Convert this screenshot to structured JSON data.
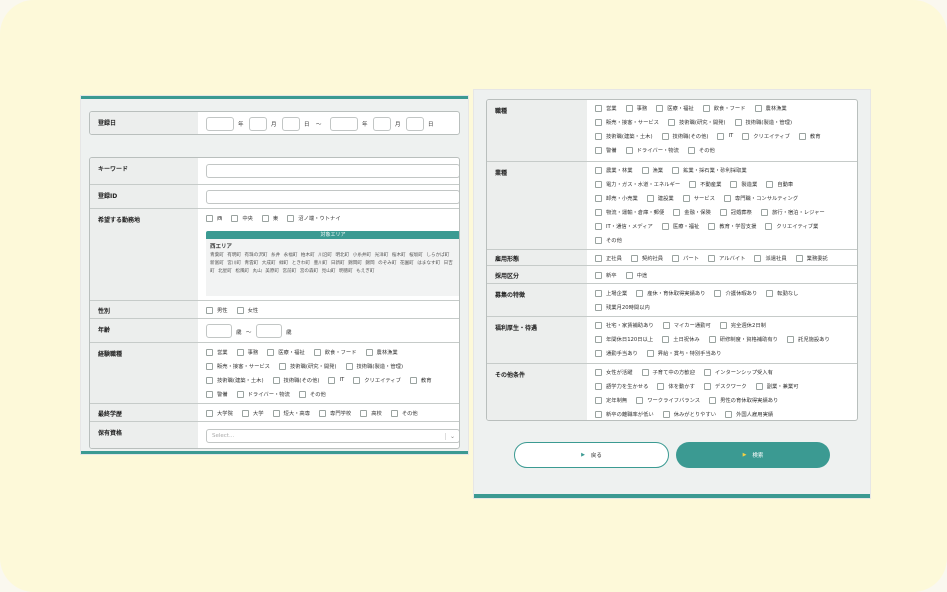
{
  "left": {
    "date": {
      "label": "登録日",
      "year": "年",
      "month": "月",
      "day": "日",
      "tilde": "〜"
    },
    "keyword": {
      "label": "キーワード"
    },
    "register_id": {
      "label": "登録ID"
    },
    "location": {
      "label": "希望する勤務地",
      "options": [
        "西",
        "中央",
        "東",
        "沼ノ端・ウトナイ"
      ],
      "area_header": "対象エリア",
      "area_title": "西エリア",
      "towns": [
        "青葉町",
        "有明町",
        "有珠の沢町",
        "糸井",
        "永福町",
        "柏木町",
        "川沿町",
        "明北町",
        "小糸井町",
        "光洋町",
        "桜木町",
        "桜坂町",
        "しらかば町",
        "新富町",
        "宮川町",
        "青雲町",
        "大成町",
        "緑町",
        "ときわ町",
        "豊川町",
        "日新町",
        "錦岡町",
        "錦岡",
        "のぞみ町",
        "花園町",
        "はまなす町",
        "日吉町",
        "北星町",
        "松風町",
        "丸山",
        "美原町",
        "宮前町",
        "宮の森町",
        "見山町",
        "明徳町",
        "もえぎ町"
      ]
    },
    "gender": {
      "label": "性別",
      "options": [
        "男性",
        "女性"
      ]
    },
    "age": {
      "label": "年齢",
      "unit": "歳",
      "tilde": "〜"
    },
    "experience": {
      "label": "経験職種",
      "lines": [
        [
          "営業",
          "事務",
          "医療・福祉",
          "飲食・フード",
          "農林漁業"
        ],
        [
          "販売・接客・サービス",
          "技術職(研究・開発)",
          "技術職(製造・管理)"
        ],
        [
          "技術職(建築・土木)",
          "技術職(その他)",
          "IT",
          "クリエイティブ",
          "教育"
        ],
        [
          "警備",
          "ドライバー・物流",
          "その他"
        ]
      ]
    },
    "education": {
      "label": "最終学歴",
      "options": [
        "大学院",
        "大学",
        "短大・高専",
        "専門学校",
        "高校",
        "その他"
      ]
    },
    "license": {
      "label": "保有資格",
      "placeholder": "Select..."
    }
  },
  "right": {
    "occupation": {
      "label": "職種",
      "lines": [
        [
          "営業",
          "事務",
          "医療・福祉",
          "飲食・フード",
          "農林漁業"
        ],
        [
          "販売・接客・サービス",
          "技術職(研究・開発)",
          "技術職(製造・管理)"
        ],
        [
          "技術職(建築・土木)",
          "技術職(その他)",
          "IT",
          "クリエイティブ",
          "教育"
        ],
        [
          "警備",
          "ドライバー・物流",
          "その他"
        ]
      ]
    },
    "industry": {
      "label": "業種",
      "lines": [
        [
          "農業・林業",
          "漁業",
          "鉱業・採石業・砂利採取業"
        ],
        [
          "電力・ガス・水道・エネルギー",
          "不動産業",
          "製造業",
          "自動車"
        ],
        [
          "卸売・小売業",
          "建設業",
          "サービス",
          "専門職・コンサルティング"
        ],
        [
          "物流・運輸・倉庫・郵便",
          "金融・保険",
          "冠婚葬祭",
          "旅行・宿泊・レジャー"
        ],
        [
          "IT・通信・メディア",
          "医療・福祉",
          "教育・学習支援",
          "クリエイティブ業"
        ],
        [
          "その他"
        ]
      ]
    },
    "employment": {
      "label": "雇用形態",
      "options": [
        "正社員",
        "契約社員",
        "パート",
        "アルバイト",
        "派遣社員",
        "業務委託"
      ]
    },
    "hiring": {
      "label": "採用区分",
      "options": [
        "新卒",
        "中途"
      ]
    },
    "features": {
      "label": "募集の特徴",
      "lines": [
        [
          "上場企業",
          "産休・育休取得実績あり",
          "介護休暇あり",
          "転勤なし"
        ],
        [
          "残業月20時間以内"
        ]
      ]
    },
    "welfare": {
      "label": "福利厚生・待遇",
      "lines": [
        [
          "社宅・家賃補助あり",
          "マイカー通勤可",
          "完全週休2日制"
        ],
        [
          "年間休日120日以上",
          "土日祝休み",
          "研修制度・資格補助有り",
          "託児施設あり"
        ],
        [
          "通勤手当あり",
          "昇給・賞与・特別手当あり"
        ]
      ]
    },
    "other": {
      "label": "その他条件",
      "lines": [
        [
          "女性が活躍",
          "子育て中の方歓迎",
          "インターンシップ受入有"
        ],
        [
          "語学力を生かせる",
          "体を動かす",
          "デスクワーク",
          "副業・兼業可"
        ],
        [
          "定年制無",
          "ワークライフバランス",
          "男性の育休取得実績あり"
        ],
        [
          "新卒の離職率が低い",
          "休みがとりやすい",
          "外国人雇用実績"
        ]
      ]
    },
    "buttons": {
      "back": "戻る",
      "search": "検索"
    }
  }
}
